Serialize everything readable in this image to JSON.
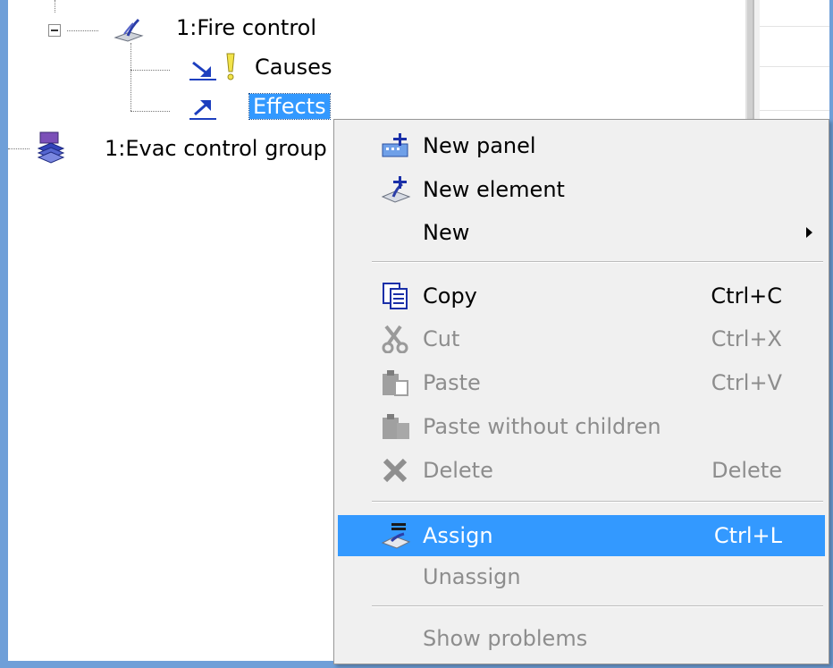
{
  "tree": {
    "items": [
      {
        "label": "1:Fire control",
        "icon": "fire-control-icon"
      },
      {
        "label": "Causes",
        "icon": "causes-icon",
        "warning_icon": "warning-exclamation-icon"
      },
      {
        "label": "Effects",
        "icon": "effects-icon"
      },
      {
        "label": "1:Evac control group",
        "icon": "evac-group-icon"
      }
    ]
  },
  "context_menu": {
    "new_panel": "New panel",
    "new_element": "New element",
    "new": "New",
    "copy": "Copy",
    "copy_shortcut": "Ctrl+C",
    "cut": "Cut",
    "cut_shortcut": "Ctrl+X",
    "paste": "Paste",
    "paste_shortcut": "Ctrl+V",
    "paste_without_children": "Paste without children",
    "delete": "Delete",
    "delete_shortcut": "Delete",
    "assign": "Assign",
    "assign_shortcut": "Ctrl+L",
    "unassign": "Unassign",
    "show_problems": "Show problems"
  },
  "colors": {
    "selection": "#3399ff",
    "menu_background": "#f0f0f0",
    "disabled_text": "#8d8d8d",
    "frame": "#6f9fd8"
  }
}
